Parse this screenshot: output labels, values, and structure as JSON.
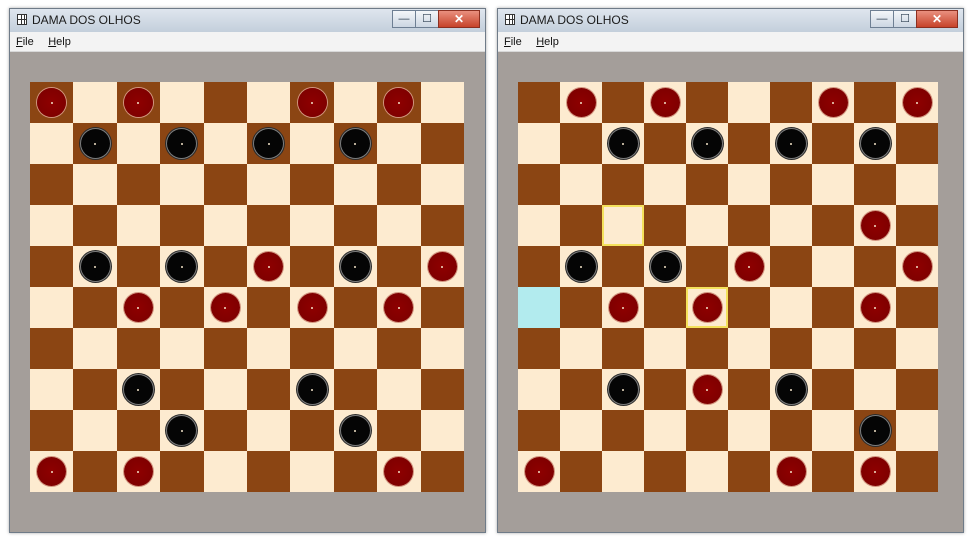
{
  "colors": {
    "light_square": "#fdebd0",
    "dark_square": "#8b4513",
    "red_piece": "#800000",
    "black_piece": "#050505",
    "window_bg": "#a49e9a",
    "highlight_selected": "#f4e15c",
    "highlight_target": "#b2ebee"
  },
  "windows": [
    {
      "title": "DAMA DOS OLHOS",
      "menu": [
        "File",
        "Help"
      ],
      "controls": {
        "minimize": "—",
        "maximize": "☐",
        "close": "✕"
      },
      "board": [
        "r.r...r.r",
        ".b.b.b.b..",
        "..........",
        "..........",
        ".b.b.r.b.r",
        "..r.r.r.r.",
        "..........",
        "..b...b...",
        "...b...b..",
        "r.r.....r."
      ]
    },
    {
      "title": "DAMA DOS OLHOS",
      "menu": [
        "File",
        "Help"
      ],
      "controls": {
        "minimize": "—",
        "maximize": "☐",
        "close": "✕"
      },
      "board": [
        ".r.r...r.r",
        "..b.b.b.b.",
        "..........",
        "........r.",
        ".b.b.r...r",
        "..r.r...r.",
        "..........",
        "..b.r.b...",
        "........b.",
        "r.....r.r."
      ],
      "highlights": [
        {
          "row": 3,
          "col": 2,
          "type": "selected"
        },
        {
          "row": 5,
          "col": 4,
          "type": "selected"
        },
        {
          "row": 5,
          "col": 0,
          "type": "target"
        }
      ]
    }
  ]
}
